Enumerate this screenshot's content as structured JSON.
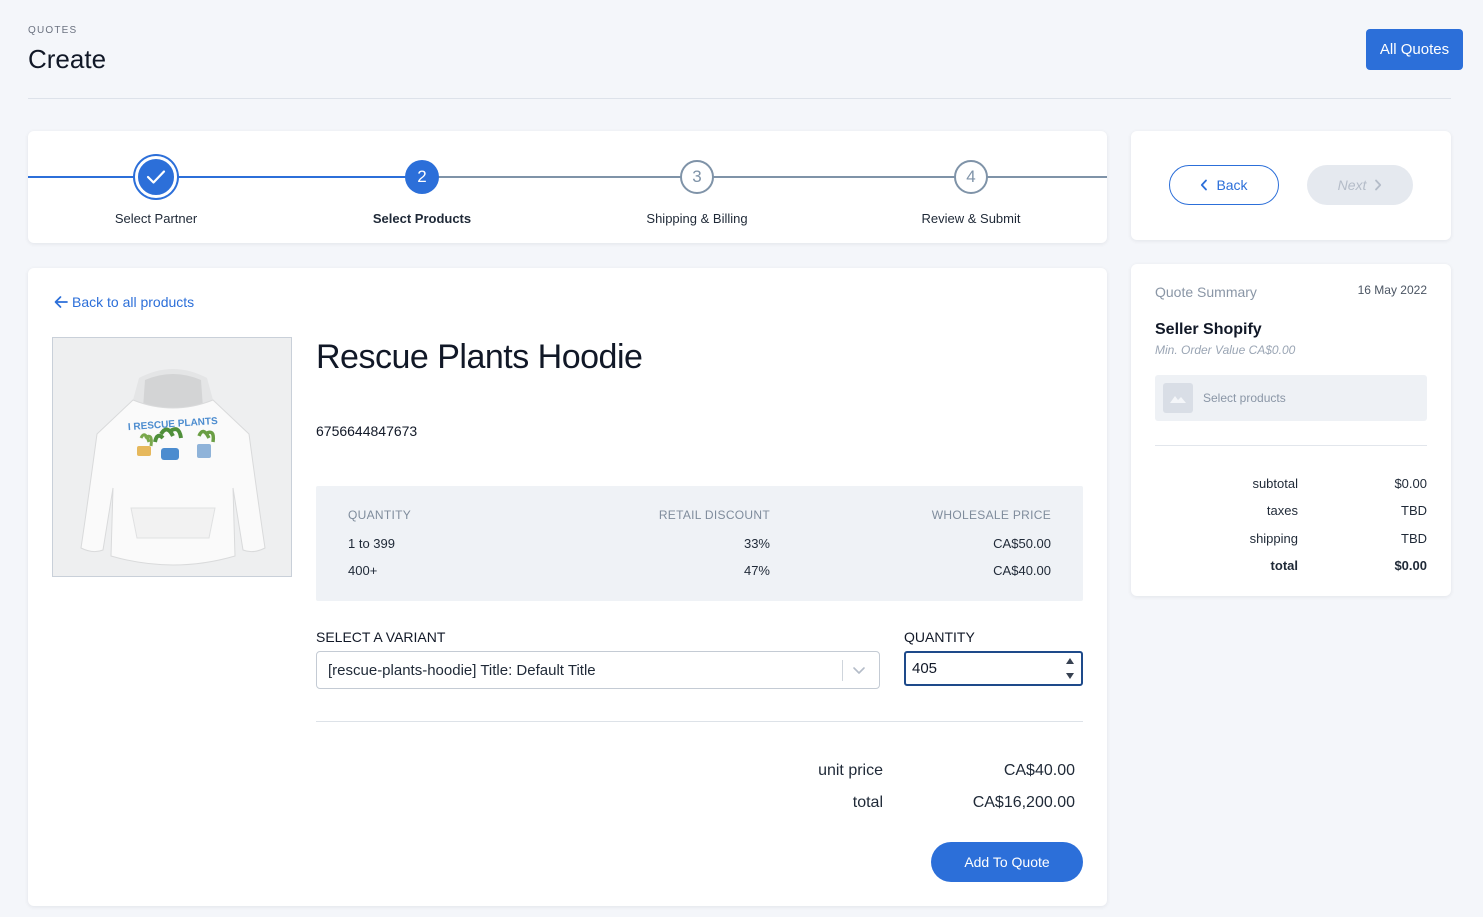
{
  "header": {
    "breadcrumb": "QUOTES",
    "title": "Create",
    "all_quotes_label": "All Quotes"
  },
  "stepper": {
    "steps": [
      {
        "number": "1",
        "label": "Select Partner",
        "state": "complete"
      },
      {
        "number": "2",
        "label": "Select Products",
        "state": "active"
      },
      {
        "number": "3",
        "label": "Shipping & Billing",
        "state": "upcoming"
      },
      {
        "number": "4",
        "label": "Review & Submit",
        "state": "upcoming"
      }
    ]
  },
  "nav": {
    "back_label": "Back",
    "next_label": "Next"
  },
  "product": {
    "back_link": "Back to all products",
    "name": "Rescue Plants Hoodie",
    "sku": "6756644847673",
    "image_text": "I RESCUE PLANTS",
    "tiers": {
      "headers": [
        "QUANTITY",
        "RETAIL DISCOUNT",
        "WHOLESALE PRICE"
      ],
      "rows": [
        [
          "1 to 399",
          "33%",
          "CA$50.00"
        ],
        [
          "400+",
          "47%",
          "CA$40.00"
        ]
      ]
    },
    "variant_label": "SELECT A VARIANT",
    "variant_value": "[rescue-plants-hoodie] Title: Default Title",
    "quantity_label": "QUANTITY",
    "quantity_value": "405",
    "unit_price_label": "unit price",
    "unit_price_value": "CA$40.00",
    "total_label": "total",
    "total_value": "CA$16,200.00",
    "add_label": "Add To Quote"
  },
  "summary": {
    "title": "Quote Summary",
    "date": "16 May 2022",
    "seller": "Seller Shopify",
    "min_order": "Min. Order Value CA$0.00",
    "empty_text": "Select products",
    "rows": [
      {
        "label": "subtotal",
        "value": "$0.00"
      },
      {
        "label": "taxes",
        "value": "TBD"
      },
      {
        "label": "shipping",
        "value": "TBD"
      },
      {
        "label": "total",
        "value": "$0.00"
      }
    ]
  },
  "colors": {
    "primary": "#2c6fd9",
    "background": "#f4f6fa",
    "disabled": "#e5e9ef"
  },
  "icons": [
    "check-icon",
    "chevron-left-icon",
    "chevron-right-icon",
    "arrow-left-icon",
    "chevron-down-icon",
    "image-placeholder-icon",
    "spinner-arrows-icon"
  ]
}
